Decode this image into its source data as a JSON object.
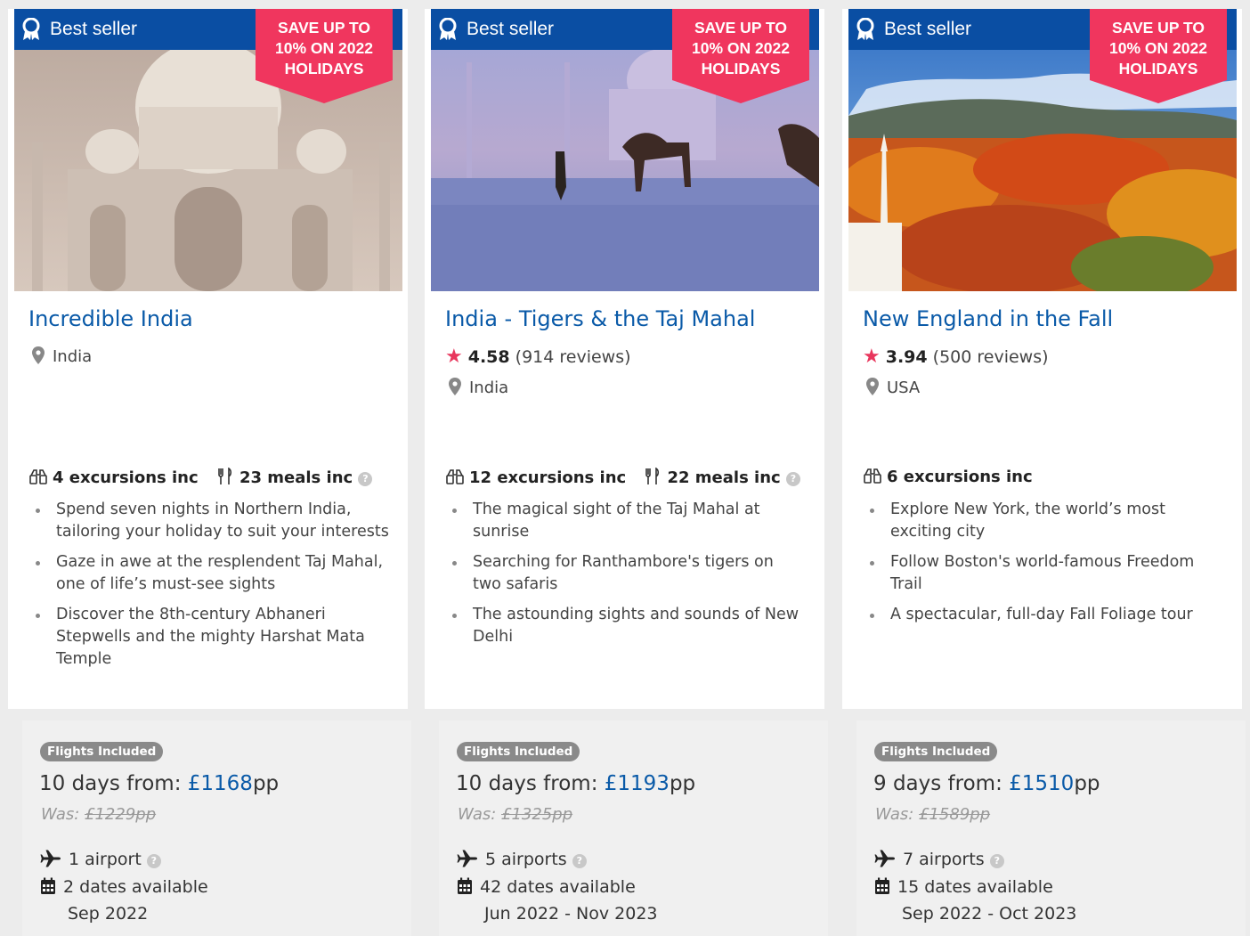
{
  "cards": [
    {
      "best_seller": "Best seller",
      "save_badge": [
        "SAVE UP TO",
        "10% ON 2022",
        "HOLIDAYS"
      ],
      "title": "Incredible India",
      "location": "India",
      "excursions": "4 excursions inc",
      "meals": "23 meals inc",
      "highlights": [
        "Spend seven nights in Northern India, tailoring your holiday to suit your interests",
        "Gaze in awe at the resplendent Taj Mahal, one of life’s must-see sights",
        "Discover the 8th-century Abhaneri Stepwells and the mighty Harshat Mata Temple"
      ],
      "flights_badge": "Flights Included",
      "duration_prefix": "10 days from: ",
      "price": "£1168",
      "price_suffix": "pp",
      "was_label": "Was: ",
      "was_price": "£1229pp",
      "airports": "1 airport",
      "dates_available": "2 dates available",
      "date_range": "Sep 2022"
    },
    {
      "best_seller": "Best seller",
      "save_badge": [
        "SAVE UP TO",
        "10% ON 2022",
        "HOLIDAYS"
      ],
      "title": "India - Tigers & the Taj Mahal",
      "rating_score": "4.58",
      "rating_reviews": "(914 reviews)",
      "location": "India",
      "excursions": "12 excursions inc",
      "meals": "22 meals inc",
      "highlights": [
        "The magical sight of the Taj Mahal at sunrise",
        "Searching for Ranthambore's tigers on two safaris",
        "The astounding sights and sounds of New Delhi"
      ],
      "flights_badge": "Flights Included",
      "duration_prefix": "10 days from: ",
      "price": "£1193",
      "price_suffix": "pp",
      "was_label": "Was: ",
      "was_price": "£1325pp",
      "airports": "5 airports",
      "dates_available": "42 dates available",
      "date_range": "Jun 2022 - Nov 2023"
    },
    {
      "best_seller": "Best seller",
      "save_badge": [
        "SAVE UP TO",
        "10% ON 2022",
        "HOLIDAYS"
      ],
      "title": "New England in the Fall",
      "rating_score": "3.94",
      "rating_reviews": "(500 reviews)",
      "location": "USA",
      "excursions": "6 excursions inc",
      "highlights": [
        "Explore New York, the world’s most exciting city",
        "Follow Boston's world-famous Freedom Trail",
        "A spectacular, full-day Fall Foliage tour"
      ],
      "flights_badge": "Flights Included",
      "duration_prefix": "9 days from: ",
      "price": "£1510",
      "price_suffix": "pp",
      "was_label": "Was: ",
      "was_price": "£1589pp",
      "airports": "7 airports",
      "dates_available": "15 dates available",
      "date_range": "Sep 2022 - Oct 2023"
    }
  ],
  "colors": {
    "brand_blue": "#0a4ea3",
    "title_blue": "#0a5aa8",
    "badge_pink": "#f0365e",
    "star_pink": "#e8365c"
  },
  "icons": {
    "best_seller": "award-ribbon-icon",
    "location": "map-pin-icon",
    "excursions": "binoculars-icon",
    "meals": "fork-knife-icon",
    "help": "question-circle-icon",
    "airports": "airplane-icon",
    "dates": "calendar-icon",
    "rating": "star-icon"
  }
}
